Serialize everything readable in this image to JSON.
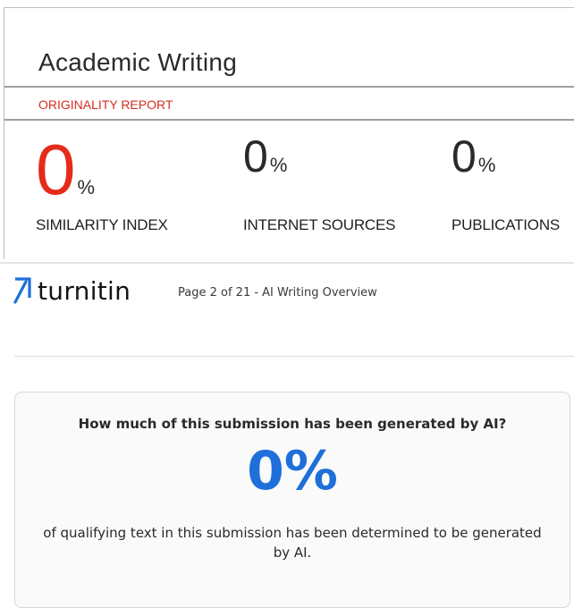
{
  "report": {
    "title": "Academic Writing",
    "label": "ORIGINALITY REPORT",
    "metrics": [
      {
        "value": "0",
        "unit": "%",
        "caption": "SIMILARITY INDEX"
      },
      {
        "value": "0",
        "unit": "%",
        "caption": "INTERNET SOURCES"
      },
      {
        "value": "0",
        "unit": "%",
        "caption": "PUBLICATIONS"
      }
    ]
  },
  "overview": {
    "logo_text": "turnitin",
    "logo_icon": "turnitin-logo-icon",
    "page_info": "Page 2 of 21 - AI Writing Overview",
    "question": "How much of this submission has been generated by AI?",
    "percent": "0%",
    "description": "of qualifying text in this submission has been determined to be generated by AI."
  },
  "colors": {
    "similarity_red": "#e52b1a",
    "report_label_red": "#d32f20",
    "ai_percent_blue": "#1e6fd9",
    "logo_blue": "#1e6fd9"
  }
}
